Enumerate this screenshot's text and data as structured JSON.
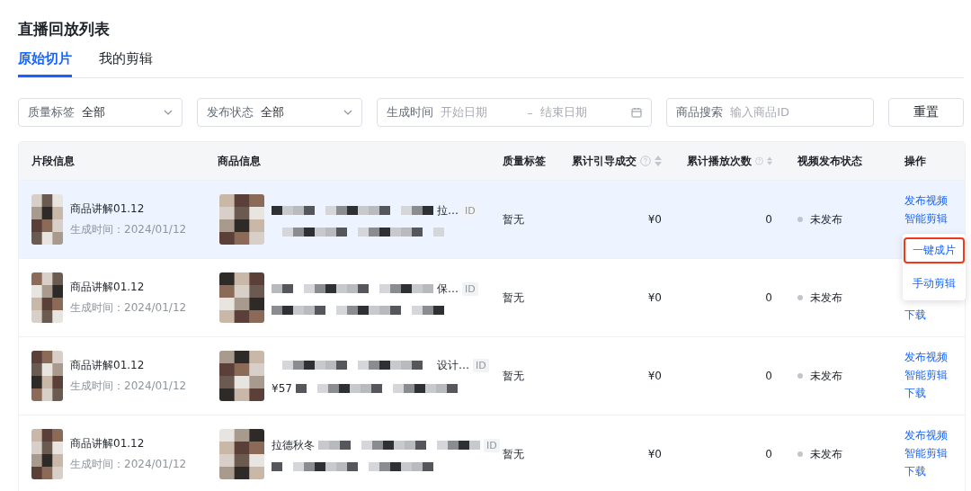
{
  "title": "直播回放列表",
  "tabs": [
    {
      "label": "原始切片",
      "selected": true
    },
    {
      "label": "我的剪辑",
      "selected": false
    }
  ],
  "filters": {
    "quality": {
      "label": "质量标签",
      "value": "全部"
    },
    "status": {
      "label": "发布状态",
      "value": "全部"
    },
    "time": {
      "label": "生成时间",
      "start_placeholder": "开始日期",
      "separator": "–",
      "end_placeholder": "结束日期"
    },
    "search": {
      "label": "商品搜索",
      "placeholder": "输入商品ID"
    },
    "reset": "重置"
  },
  "table": {
    "columns": [
      {
        "label": "片段信息"
      },
      {
        "label": "商品信息"
      },
      {
        "label": "质量标签"
      },
      {
        "label": "累计引导成交",
        "sortable": true
      },
      {
        "label": "累计播放次数",
        "sortable": true
      },
      {
        "label": "视频发布状态"
      },
      {
        "label": "操作"
      }
    ],
    "rows": [
      {
        "hovered": true,
        "clip": {
          "name": "商品讲解01.12",
          "time": "生成时间：2024/01/12"
        },
        "product": {
          "title_parts": [
            {
              "kind": "redacted"
            },
            {
              "kind": "text",
              "text": "拉…"
            }
          ],
          "detail_parts": [
            {
              "kind": "redacted"
            }
          ],
          "id_tag": "ID"
        },
        "quality": "暂无",
        "gmv": "¥0",
        "plays": "0",
        "status": "未发布",
        "actions": [
          {
            "kind": "publish",
            "label": "发布视频"
          },
          {
            "kind": "smart-edit",
            "label": "智能剪辑"
          }
        ],
        "menu": {
          "items": [
            {
              "label": "一键成片",
              "selected": true
            },
            {
              "label": "手动剪辑",
              "selected": false
            }
          ]
        }
      },
      {
        "hovered": false,
        "clip": {
          "name": "商品讲解01.12",
          "time": "生成时间：2024/01/12"
        },
        "product": {
          "title_parts": [
            {
              "kind": "redacted"
            },
            {
              "kind": "text",
              "text": "保…"
            }
          ],
          "detail_parts": [
            {
              "kind": "redacted"
            }
          ],
          "id_tag": "ID"
        },
        "quality": "暂无",
        "gmv": "¥0",
        "plays": "0",
        "status": "未发布",
        "actions": [
          {
            "kind": "download",
            "label": "下载"
          }
        ]
      },
      {
        "hovered": false,
        "clip": {
          "name": "商品讲解01.12",
          "time": "生成时间：2024/01/12"
        },
        "product": {
          "title_parts": [
            {
              "kind": "redacted"
            },
            {
              "kind": "text",
              "text": "设计…"
            }
          ],
          "detail_parts": [
            {
              "kind": "text",
              "text": "¥57"
            },
            {
              "kind": "redacted"
            }
          ],
          "id_tag": "ID"
        },
        "quality": "暂无",
        "gmv": "¥0",
        "plays": "0",
        "status": "未发布",
        "actions": [
          {
            "kind": "publish",
            "label": "发布视频"
          },
          {
            "kind": "smart-edit",
            "label": "智能剪辑"
          },
          {
            "kind": "download",
            "label": "下载"
          }
        ]
      },
      {
        "hovered": false,
        "clip": {
          "name": "商品讲解01.12",
          "time": "生成时间：2024/01/12"
        },
        "product": {
          "title_parts": [
            {
              "kind": "text",
              "text": "拉德秋冬"
            },
            {
              "kind": "redacted"
            }
          ],
          "detail_parts": [
            {
              "kind": "redacted"
            }
          ],
          "id_tag": "ID"
        },
        "quality": "暂无",
        "gmv": "¥0",
        "plays": "0",
        "status": "未发布",
        "actions": [
          {
            "kind": "publish",
            "label": "发布视频"
          },
          {
            "kind": "smart-edit",
            "label": "智能剪辑"
          },
          {
            "kind": "download",
            "label": "下载"
          }
        ]
      }
    ]
  }
}
